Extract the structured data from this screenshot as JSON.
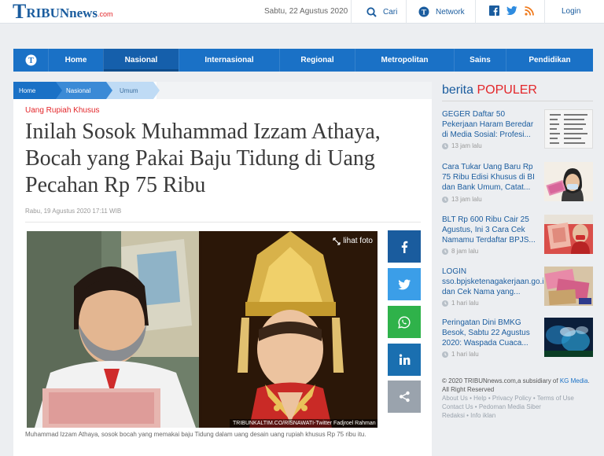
{
  "site": {
    "logo_mark": "T",
    "logo_text": "RIBUNnews",
    "logo_domain": ".com",
    "brand_blue": "#1a5c9e",
    "accent_red": "#e3262a"
  },
  "topbar": {
    "date": "Sabtu, 22 Agustus 2020",
    "search_label": "Cari",
    "network_label": "Network",
    "login_label": "Login"
  },
  "nav": {
    "items": [
      "Home",
      "Nasional",
      "Internasional",
      "Regional",
      "Metropolitan",
      "Sains",
      "Pendidikan"
    ],
    "active": "Nasional"
  },
  "breadcrumb": [
    "Home",
    "Nasional",
    "Umum"
  ],
  "article": {
    "kicker": "Uang Rupiah Khusus",
    "title": "Inilah Sosok Muhammad Izzam Athaya, Bocah yang Pakai Baju Tidung di Uang Pecahan Rp 75 Ribu",
    "date": "Rabu, 19 Agustus 2020 17:11 WIB",
    "photo_action": "lihat foto",
    "photo_credit": "TRIBUNKALTIM.CO/RISNAWATI-Twitter Fadjroel Rahman",
    "caption": "Muhammad Izzam Athaya, sosok bocah yang memakai baju Tidung dalam uang desain uang rupiah khusus Rp 75 ribu itu."
  },
  "share": [
    {
      "name": "facebook",
      "color": "#1a5c9e"
    },
    {
      "name": "twitter",
      "color": "#3b9ee8"
    },
    {
      "name": "whatsapp",
      "color": "#2fb24a"
    },
    {
      "name": "linkedin",
      "color": "#1a6fb0"
    },
    {
      "name": "share",
      "color": "#9aa3ad"
    }
  ],
  "popular": {
    "title_prefix": "berita",
    "title_suffix": "POPULER",
    "items": [
      {
        "title": "GEGER Daftar 50 Pekerjaan Haram Beredar di Media Sosial: Profesi...",
        "time": "13 jam lalu"
      },
      {
        "title": "Cara Tukar Uang Baru Rp 75 Ribu Edisi Khusus di BI dan Bank Umum, Catat...",
        "time": "13 jam lalu"
      },
      {
        "title": "BLT Rp 600 Ribu Cair 25 Agustus, Ini 3 Cara Cek Namamu Terdaftar BPJS...",
        "time": "8 jam lalu"
      },
      {
        "title": "LOGIN sso.bpjsketenagakerjaan.go.id dan Cek Nama yang...",
        "time": "1 hari lalu"
      },
      {
        "title": "Peringatan Dini BMKG Besok, Sabtu 22 Agustus 2020: Waspada Cuaca...",
        "time": "1 hari lalu"
      }
    ]
  },
  "footer": {
    "copyright": "© 2020 TRIBUNnews.com,a subsidiary of",
    "parent": "KG Media",
    "rights": ". All Right Reserved",
    "links_line1": "About Us  •  Help  •  Privacy Policy  •  Terms of Use",
    "links_line2": "Contact Us  •  Pedoman Media Siber",
    "links_line3": "Redaksi  •  Info iklan"
  }
}
